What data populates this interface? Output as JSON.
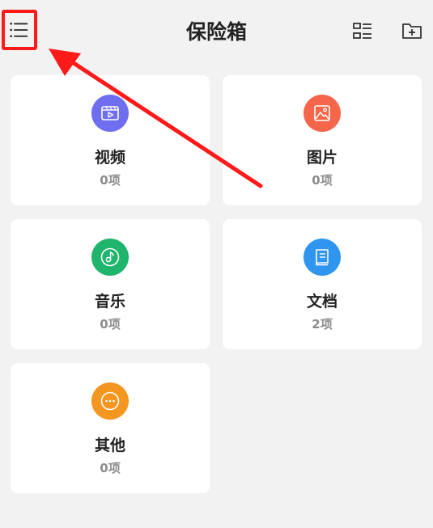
{
  "header": {
    "title": "保险箱"
  },
  "categories": [
    {
      "name": "视频",
      "count": "0项",
      "color": "#6f6ef0",
      "icon": "video-icon"
    },
    {
      "name": "图片",
      "count": "0项",
      "color": "#f5664a",
      "icon": "image-icon"
    },
    {
      "name": "音乐",
      "count": "0项",
      "color": "#1fb56c",
      "icon": "music-icon"
    },
    {
      "name": "文档",
      "count": "2项",
      "color": "#2f95ee",
      "icon": "document-icon"
    },
    {
      "name": "其他",
      "count": "0项",
      "color": "#f4961f",
      "icon": "more-icon"
    }
  ],
  "colors": {
    "highlight": "#ff1a1a",
    "background": "#f2f2f2"
  }
}
